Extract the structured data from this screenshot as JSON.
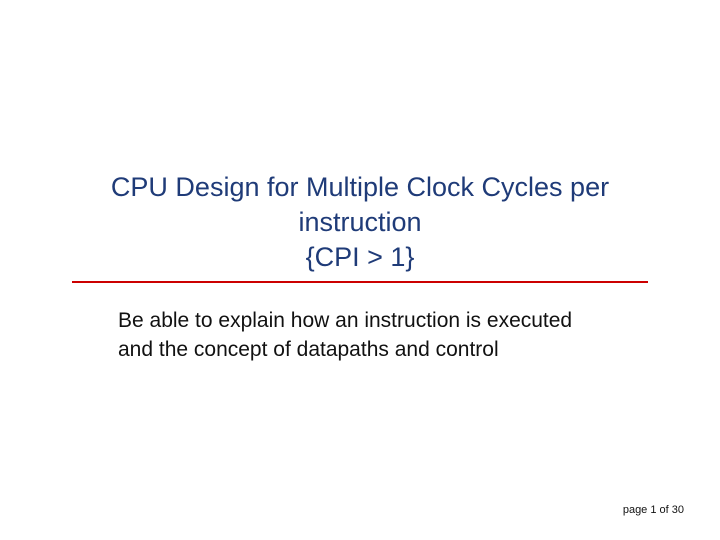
{
  "title": {
    "line1": "CPU Design for Multiple Clock Cycles per",
    "line2": "instruction",
    "line3": "{CPI > 1}"
  },
  "body": {
    "text": "Be able to explain how an instruction is executed and the concept of datapaths and control"
  },
  "footer": {
    "page_label": "page 1 of 30"
  }
}
